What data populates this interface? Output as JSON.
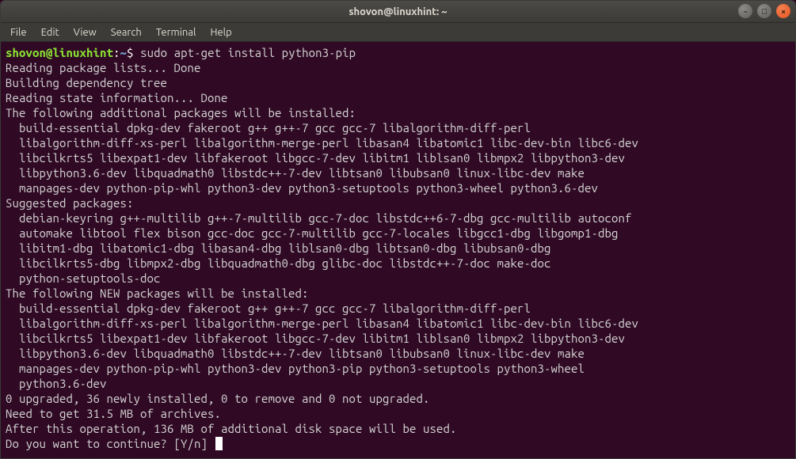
{
  "titlebar": {
    "title": "shovon@linuxhint: ~"
  },
  "window_controls": {
    "min": "–",
    "max": "□",
    "close": "×"
  },
  "menubar": {
    "items": [
      "File",
      "Edit",
      "View",
      "Search",
      "Terminal",
      "Help"
    ]
  },
  "prompt": {
    "user_host": "shovon@linuxhint",
    "sep": ":",
    "path": "~",
    "dollar": "$ ",
    "command": "sudo apt-get install python3-pip"
  },
  "output": [
    "Reading package lists... Done",
    "Building dependency tree",
    "Reading state information... Done",
    "The following additional packages will be installed:",
    "  build-essential dpkg-dev fakeroot g++ g++-7 gcc gcc-7 libalgorithm-diff-perl",
    "  libalgorithm-diff-xs-perl libalgorithm-merge-perl libasan4 libatomic1 libc-dev-bin libc6-dev",
    "  libcilkrts5 libexpat1-dev libfakeroot libgcc-7-dev libitm1 liblsan0 libmpx2 libpython3-dev",
    "  libpython3.6-dev libquadmath0 libstdc++-7-dev libtsan0 libubsan0 linux-libc-dev make",
    "  manpages-dev python-pip-whl python3-dev python3-setuptools python3-wheel python3.6-dev",
    "Suggested packages:",
    "  debian-keyring g++-multilib g++-7-multilib gcc-7-doc libstdc++6-7-dbg gcc-multilib autoconf",
    "  automake libtool flex bison gcc-doc gcc-7-multilib gcc-7-locales libgcc1-dbg libgomp1-dbg",
    "  libitm1-dbg libatomic1-dbg libasan4-dbg liblsan0-dbg libtsan0-dbg libubsan0-dbg",
    "  libcilkrts5-dbg libmpx2-dbg libquadmath0-dbg glibc-doc libstdc++-7-doc make-doc",
    "  python-setuptools-doc",
    "The following NEW packages will be installed:",
    "  build-essential dpkg-dev fakeroot g++ g++-7 gcc gcc-7 libalgorithm-diff-perl",
    "  libalgorithm-diff-xs-perl libalgorithm-merge-perl libasan4 libatomic1 libc-dev-bin libc6-dev",
    "  libcilkrts5 libexpat1-dev libfakeroot libgcc-7-dev libitm1 liblsan0 libmpx2 libpython3-dev",
    "  libpython3.6-dev libquadmath0 libstdc++-7-dev libtsan0 libubsan0 linux-libc-dev make",
    "  manpages-dev python-pip-whl python3-dev python3-pip python3-setuptools python3-wheel",
    "  python3.6-dev",
    "0 upgraded, 36 newly installed, 0 to remove and 0 not upgraded.",
    "Need to get 31.5 MB of archives.",
    "After this operation, 136 MB of additional disk space will be used.",
    "Do you want to continue? [Y/n] "
  ]
}
